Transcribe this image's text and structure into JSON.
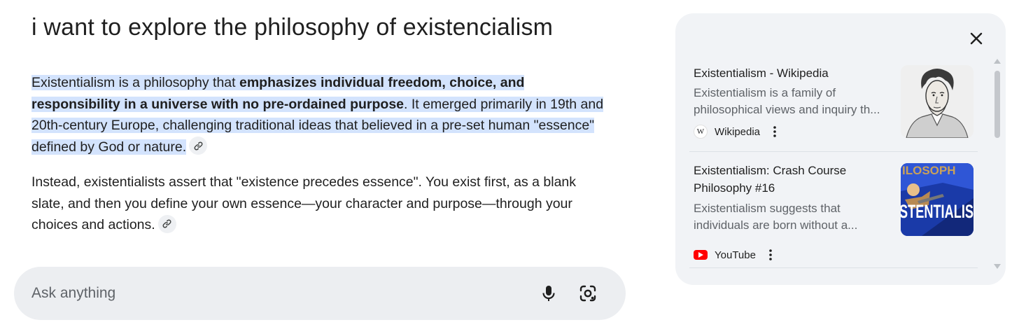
{
  "query": {
    "text": "i want to explore the philosophy of existencialism"
  },
  "answer": {
    "p1_before": "Existentialism is a philosophy that ",
    "p1_bold": "emphasizes individual freedom, choice, and responsibility in a universe with no pre-ordained purpose",
    "p1_after": ". It emerged primarily in 19th and 20th-century Europe, challenging traditional ideas that believed in a pre-set human \"essence\" defined by God or nature.",
    "p2": "Instead, existentialists assert that \"existence precedes essence\". You exist first, as a blank slate, and then you define your own essence—your character and purpose—through your choices and actions."
  },
  "ask_bar": {
    "placeholder": "Ask anything",
    "mic_icon": "mic-icon",
    "lens_icon": "lens-camera-icon"
  },
  "sources_panel": {
    "close_icon": "close-icon",
    "cards": [
      {
        "title": "Existentialism - Wikipedia",
        "snippet": "Existentialism is a family of philosophical views and inquiry th...",
        "source": "Wikipedia",
        "favicon": "wikipedia-icon",
        "thumbnail": "portrait-thumbnail"
      },
      {
        "title": "Existentialism: Crash Course Philosophy #16",
        "snippet": "Existentialism suggests that individuals are born without a...",
        "source": "YouTube",
        "favicon": "youtube-icon",
        "thumbnail": "video-thumbnail",
        "thumb_text_top": "ILOSOPH",
        "thumb_text_main": "STENTIALIS"
      }
    ]
  },
  "colors": {
    "highlight": "#d3e3fd",
    "panel_bg": "#f1f3f6",
    "askbar_bg": "#eceef1",
    "youtube_red": "#ff0000",
    "thumb_blue": "#1a3aa8"
  }
}
